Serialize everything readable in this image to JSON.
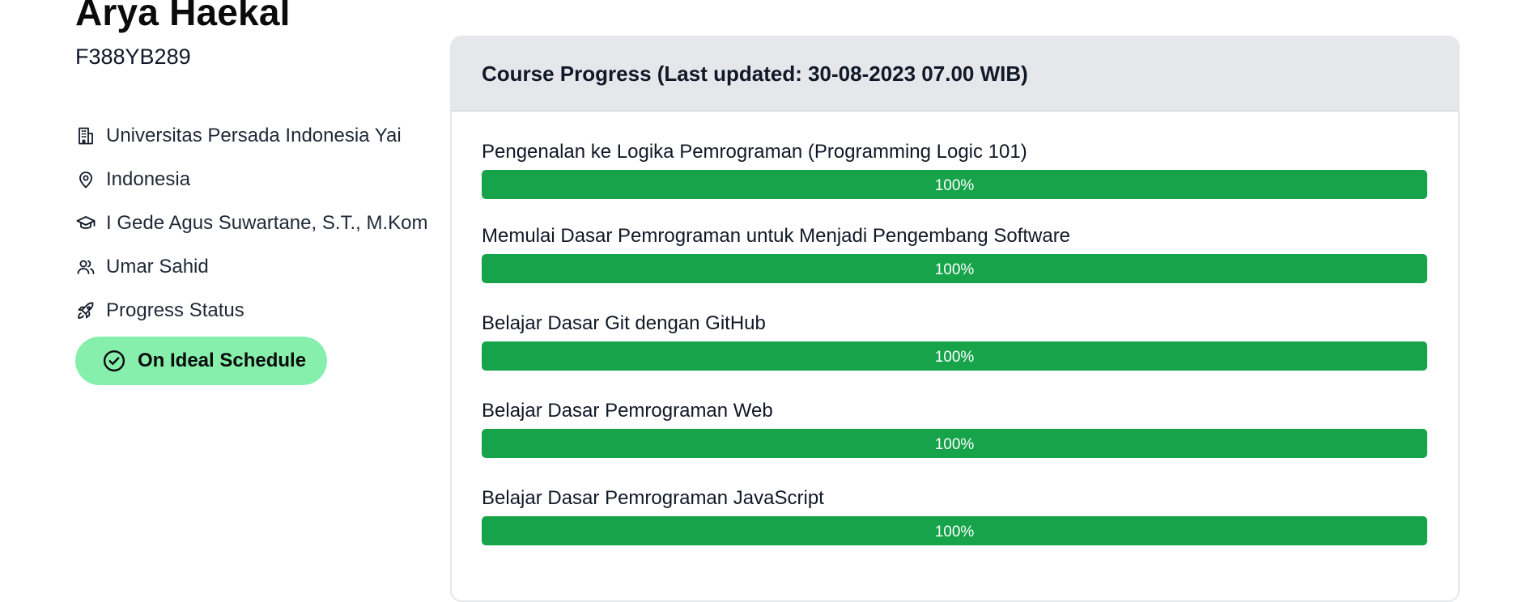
{
  "profile": {
    "name": "Arya Haekal",
    "student_id": "F388YB289",
    "info": [
      {
        "icon": "building-icon",
        "text": "Universitas Persada Indonesia Yai"
      },
      {
        "icon": "map-pin-icon",
        "text": "Indonesia"
      },
      {
        "icon": "graduation-cap-icon",
        "text": "I Gede Agus Suwartane, S.T., M.Kom"
      },
      {
        "icon": "users-icon",
        "text": "Umar Sahid"
      },
      {
        "icon": "rocket-icon",
        "text": "Progress Status"
      }
    ],
    "status_badge": {
      "icon": "check-circle-icon",
      "label": "On Ideal Schedule"
    }
  },
  "course_progress": {
    "title": "Course Progress (Last updated: 30-08-2023 07.00 WIB)",
    "courses": [
      {
        "title": "Pengenalan ke Logika Pemrograman (Programming Logic 101)",
        "progress": 100,
        "label": "100%"
      },
      {
        "title": "Memulai Dasar Pemrograman untuk Menjadi Pengembang Software",
        "progress": 100,
        "label": "100%"
      },
      {
        "title": "Belajar Dasar Git dengan GitHub",
        "progress": 100,
        "label": "100%"
      },
      {
        "title": "Belajar Dasar Pemrograman Web",
        "progress": 100,
        "label": "100%"
      },
      {
        "title": "Belajar Dasar Pemrograman JavaScript",
        "progress": 100,
        "label": "100%"
      }
    ]
  },
  "colors": {
    "progress_fill": "#16a34a",
    "badge_bg": "#86efac",
    "card_header_bg": "#e5e7eb"
  }
}
